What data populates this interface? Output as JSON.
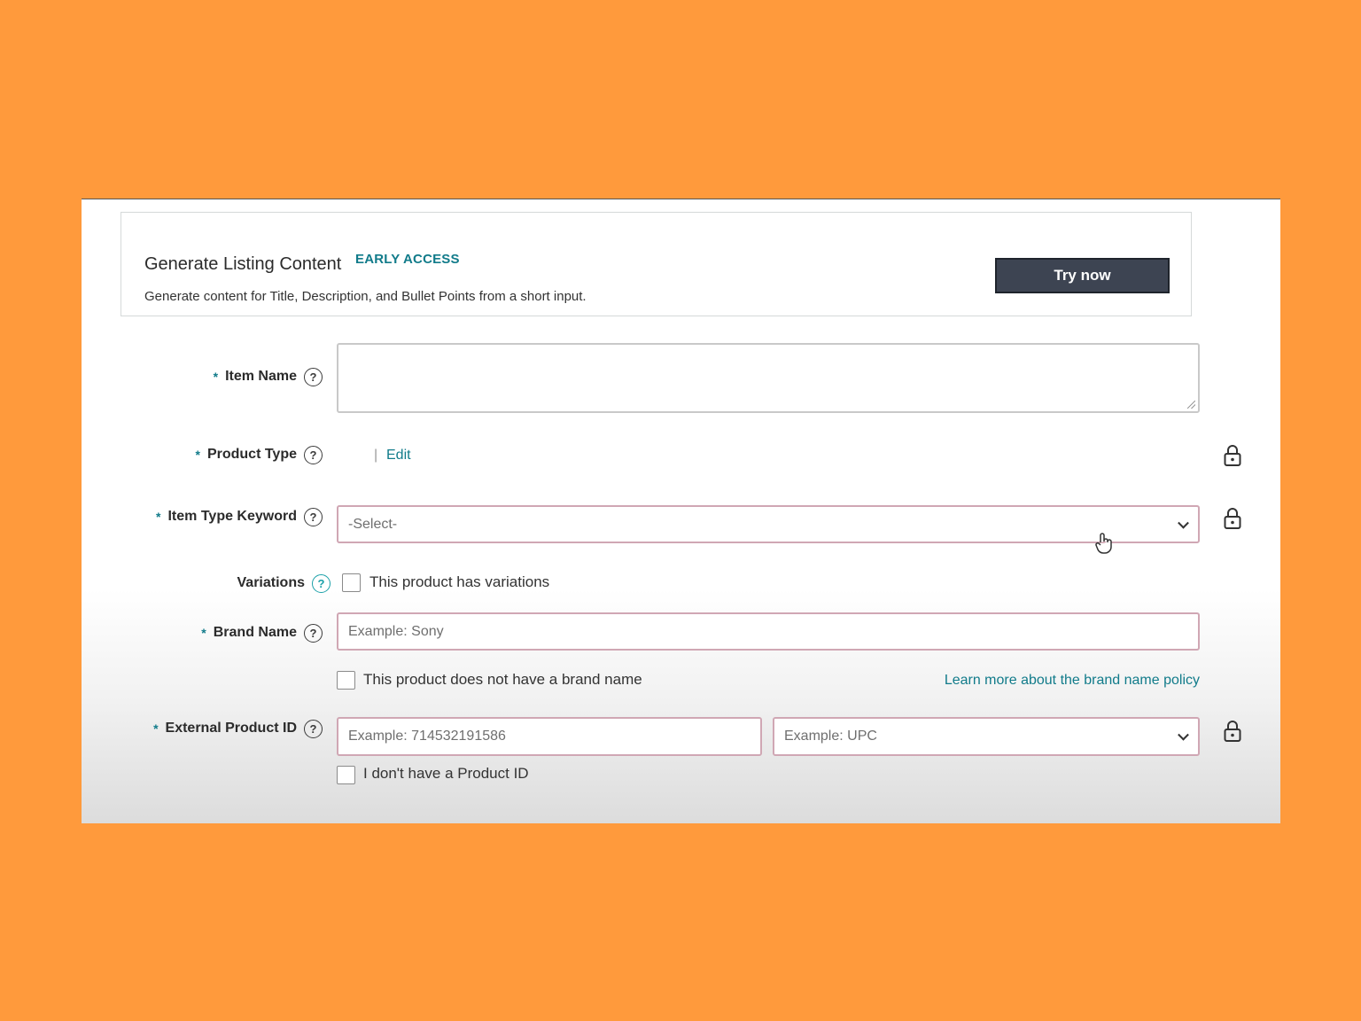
{
  "generate_box": {
    "title": "Generate Listing Content",
    "badge": "EARLY ACCESS",
    "description": "Generate content for Title, Description, and Bullet Points from a short input.",
    "button_label": "Try now"
  },
  "form": {
    "item_name": {
      "label": "Item Name",
      "required": "*",
      "help": "?",
      "value": ""
    },
    "product_type": {
      "label": "Product Type",
      "required": "*",
      "help": "?",
      "separator": "|",
      "edit_link": "Edit"
    },
    "item_type_keyword": {
      "label": "Item Type Keyword",
      "required": "*",
      "help": "?",
      "selected": "-Select-"
    },
    "variations": {
      "label": "Variations",
      "help": "?",
      "checkbox_label": "This product has variations"
    },
    "brand_name": {
      "label": "Brand Name",
      "required": "*",
      "help": "?",
      "placeholder": "Example: Sony",
      "no_brand_label": "This product does not have a brand name",
      "policy_link": "Learn more about the brand name policy"
    },
    "external_product_id": {
      "label": "External Product ID",
      "required": "*",
      "help": "?",
      "id_placeholder": "Example: 714532191586",
      "type_placeholder": "Example: UPC",
      "no_id_label": "I don't have a Product ID"
    }
  },
  "colors": {
    "background": "#FF9A3C",
    "accent_teal": "#117b8a",
    "button_dark": "#3d4452",
    "error_border": "#d0a7b4"
  }
}
